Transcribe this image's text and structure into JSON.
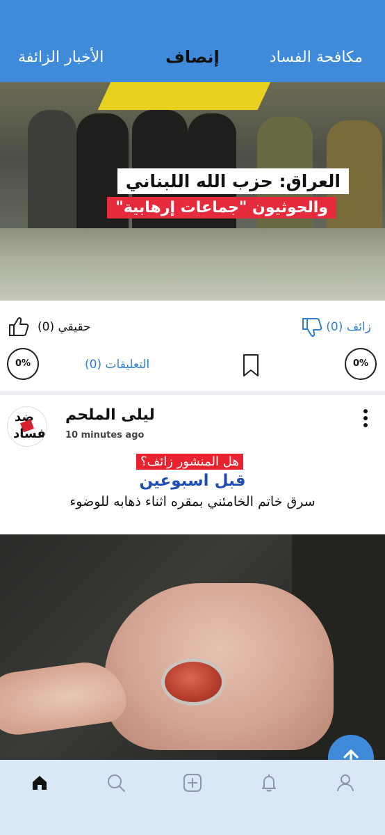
{
  "top_nav": {
    "tabs": [
      {
        "label": "مكافحة الفساد"
      },
      {
        "label": "إنصاف"
      },
      {
        "label": "الأخبار الزائفة"
      }
    ],
    "active_tab": "إنصاف",
    "background_color": "#3f8bd9"
  },
  "post1": {
    "image_headline_line1": "العراق: حزب الله اللبناني",
    "image_headline_line2": "والحوثيون \"جماعات إرهابية\"",
    "real_label": "حقيقي (0)",
    "fake_label": "زائف (0)",
    "comments_label": "التعليقات (0)",
    "real_percent": "0%",
    "fake_percent": "0%",
    "icons": [
      "thumbs-up-icon",
      "thumbs-down-icon",
      "bookmark-icon"
    ]
  },
  "post2": {
    "author": "ليلى الملحم",
    "time": "10 minutes ago",
    "avatar_text_1": "ضد",
    "avatar_text_2": "الفساد",
    "fake_question": "هل المنشور زائف؟",
    "title": "قبل اسبوعين",
    "body": "سرق خاتم الخامئني بمقره اثناء ذهابه للوضوء"
  },
  "bottom_nav": {
    "items": [
      "home-icon",
      "search-icon",
      "add-icon",
      "bell-icon",
      "user-icon"
    ],
    "background_color": "#d9e7f7"
  },
  "fab_icon": "arrow-up-icon"
}
